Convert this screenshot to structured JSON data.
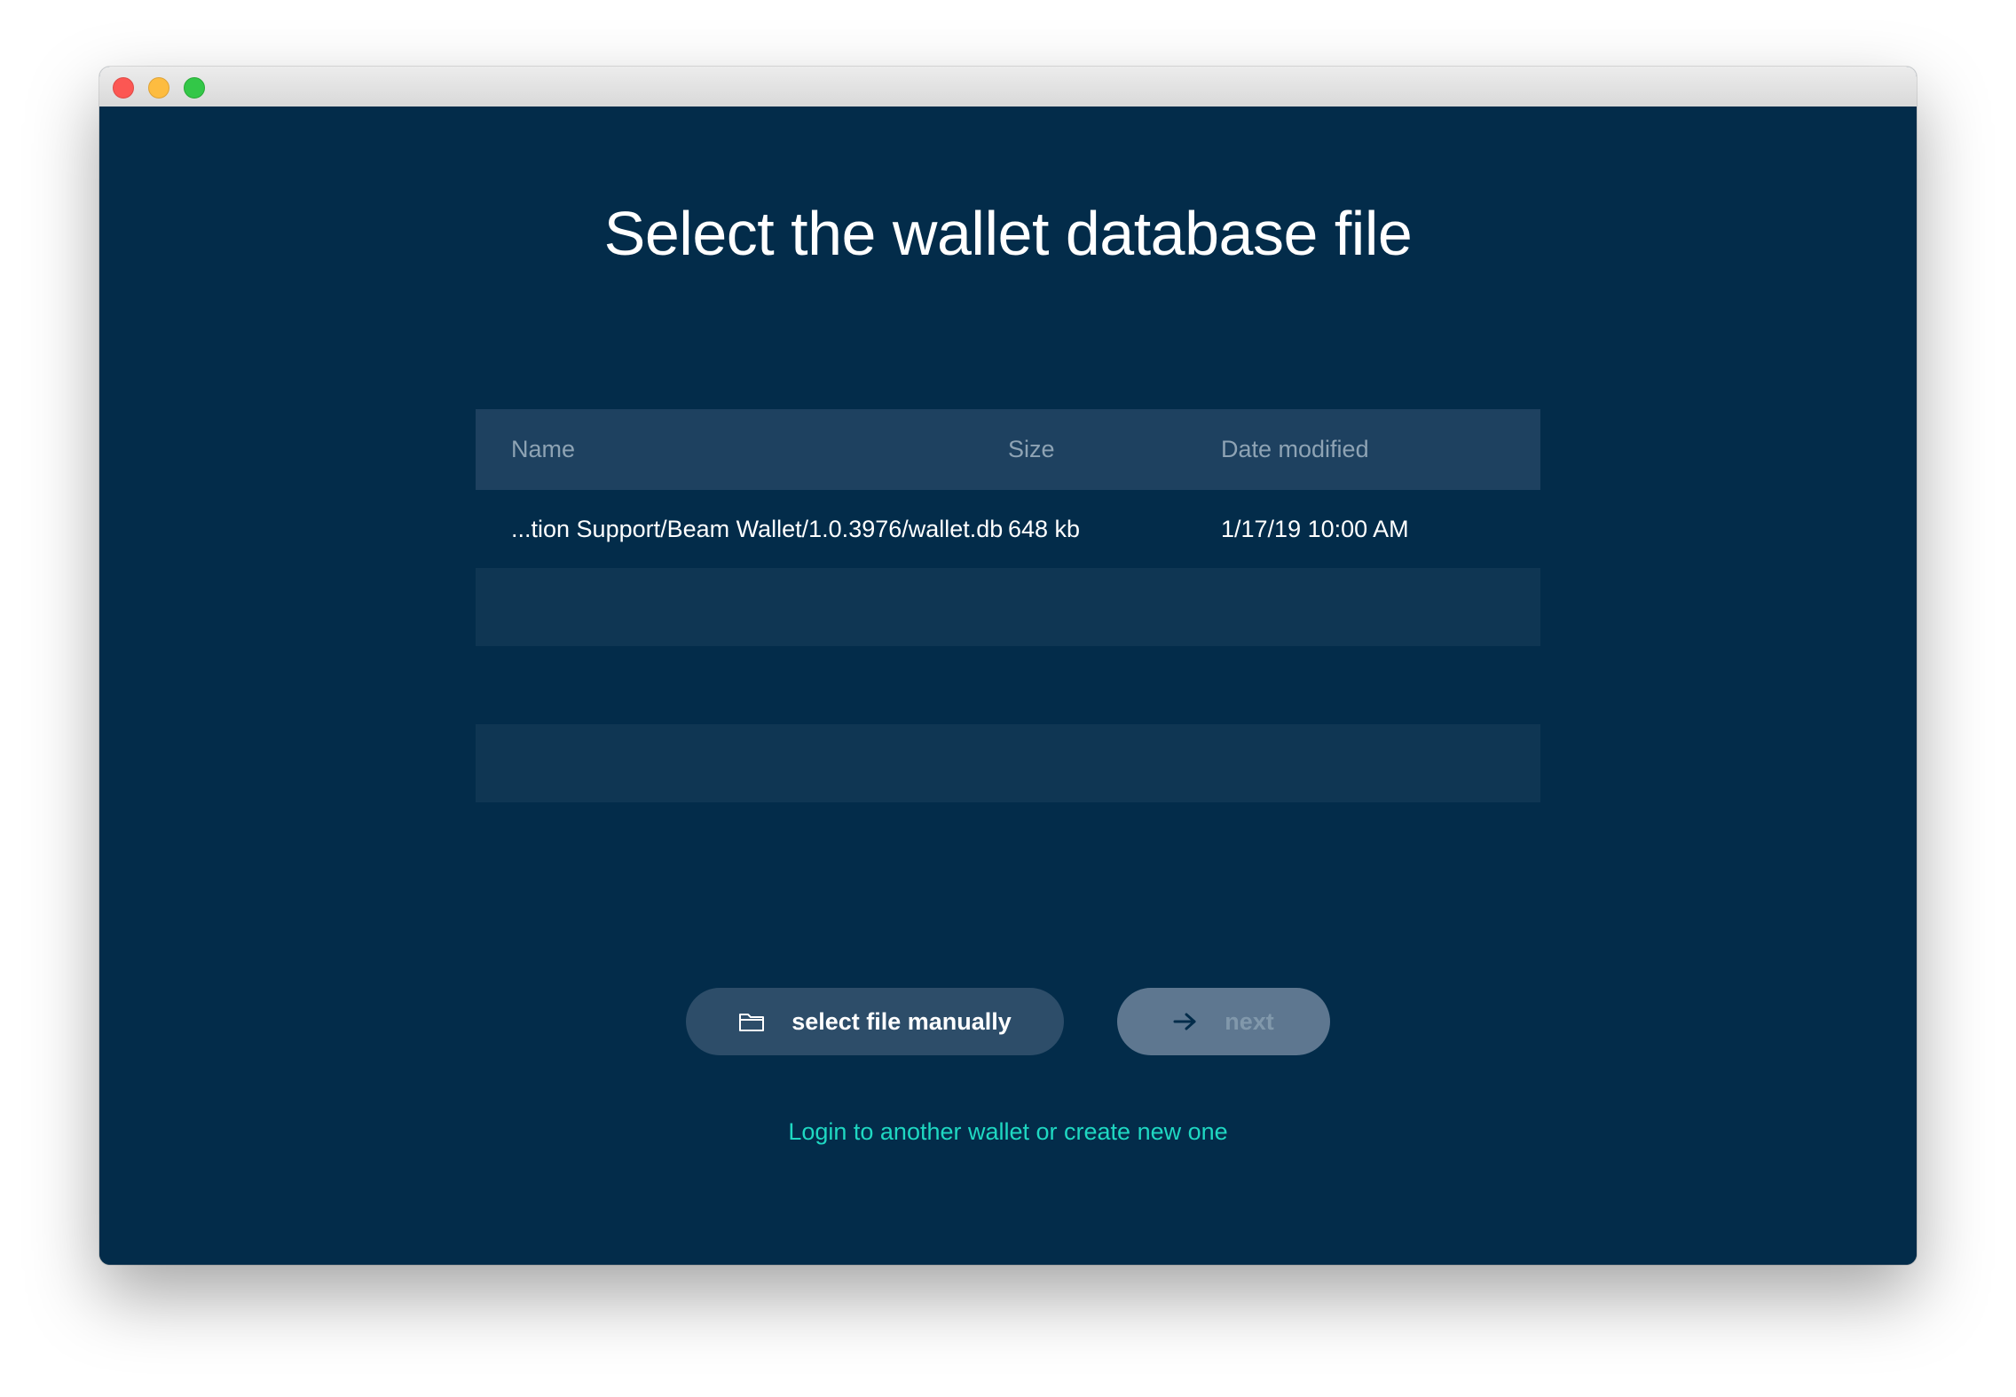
{
  "window": {
    "controls": [
      "close",
      "minimize",
      "maximize"
    ]
  },
  "page": {
    "title": "Select the wallet database file"
  },
  "table": {
    "columns": {
      "name": "Name",
      "size": "Size",
      "date": "Date modified"
    },
    "rows": [
      {
        "name": "...tion Support/Beam Wallet/1.0.3976/wallet.db",
        "size": "648 kb",
        "date": "1/17/19 10:00 AM"
      }
    ]
  },
  "actions": {
    "select_manual": {
      "label": "select file manually",
      "icon": "folder-icon"
    },
    "next": {
      "label": "next",
      "icon": "arrow-right-icon",
      "disabled": true
    }
  },
  "footer": {
    "link_label": "Login to another wallet or create new one"
  },
  "colors": {
    "background": "#032c4a",
    "table_header": "#1e4160",
    "table_row_alt": "#0f3653",
    "button_primary": "#2d4d69",
    "button_disabled": "#5e7790",
    "link": "#1fd8c2"
  }
}
